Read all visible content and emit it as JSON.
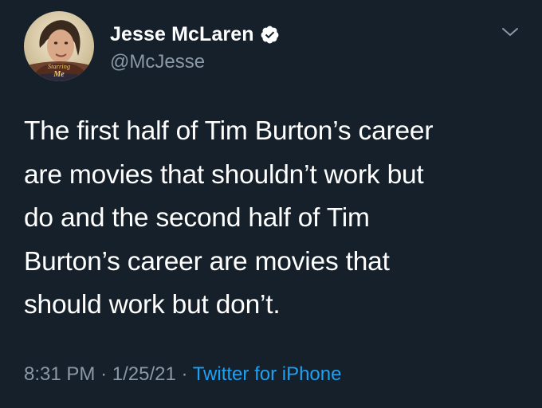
{
  "user": {
    "display_name": "Jesse McLaren",
    "handle": "@McJesse",
    "verified": true,
    "avatar_caption_line1": "Starring",
    "avatar_caption_line2": "Me"
  },
  "tweet": {
    "lines": [
      "The first half of Tim Burton’s career",
      "are movies that shouldn’t work but",
      "do and the second half of Tim",
      "Burton’s career are movies that",
      "should work but don’t."
    ],
    "time": "8:31 PM",
    "date": "1/25/21",
    "separator": "·",
    "source": "Twitter for iPhone"
  },
  "colors": {
    "background": "#15202b",
    "text": "#ffffff",
    "secondary": "#8b98a5",
    "accent": "#1da1f2"
  },
  "icons": {
    "verified": "verified-badge-icon",
    "menu": "chevron-down-icon"
  }
}
